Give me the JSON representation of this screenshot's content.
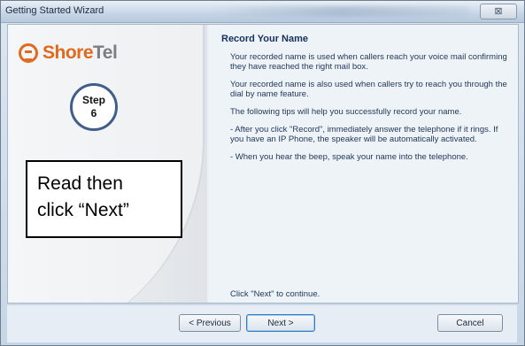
{
  "window": {
    "title": "Getting Started Wizard",
    "close_glyph": "⊠"
  },
  "sidebar": {
    "logo_part1": "Shore",
    "logo_part2": "Tel",
    "step_word": "Step",
    "step_number": "6",
    "callout_line1": "Read then",
    "callout_line2": "click “Next”"
  },
  "panel": {
    "title": "Record Your Name",
    "paragraphs": [
      "Your recorded name is used when callers reach your voice mail confirming they have reached the right mail box.",
      "Your recorded name is also used when callers try to reach you through the dial by name feature.",
      "The following tips will help you successfully record your name.",
      "- After you click \"Record\", immediately answer the telephone if it rings.  If you have an IP Phone, the speaker will be automatically activated.",
      "- When you hear the beep, speak your name into the telephone."
    ],
    "footer": "Click \"Next\" to continue."
  },
  "buttons": {
    "previous": "< Previous",
    "next": "Next >",
    "cancel": "Cancel"
  },
  "colors": {
    "brand_orange": "#e06a1e",
    "brand_gray": "#7b7f84",
    "step_ring": "#3f5e8a"
  }
}
